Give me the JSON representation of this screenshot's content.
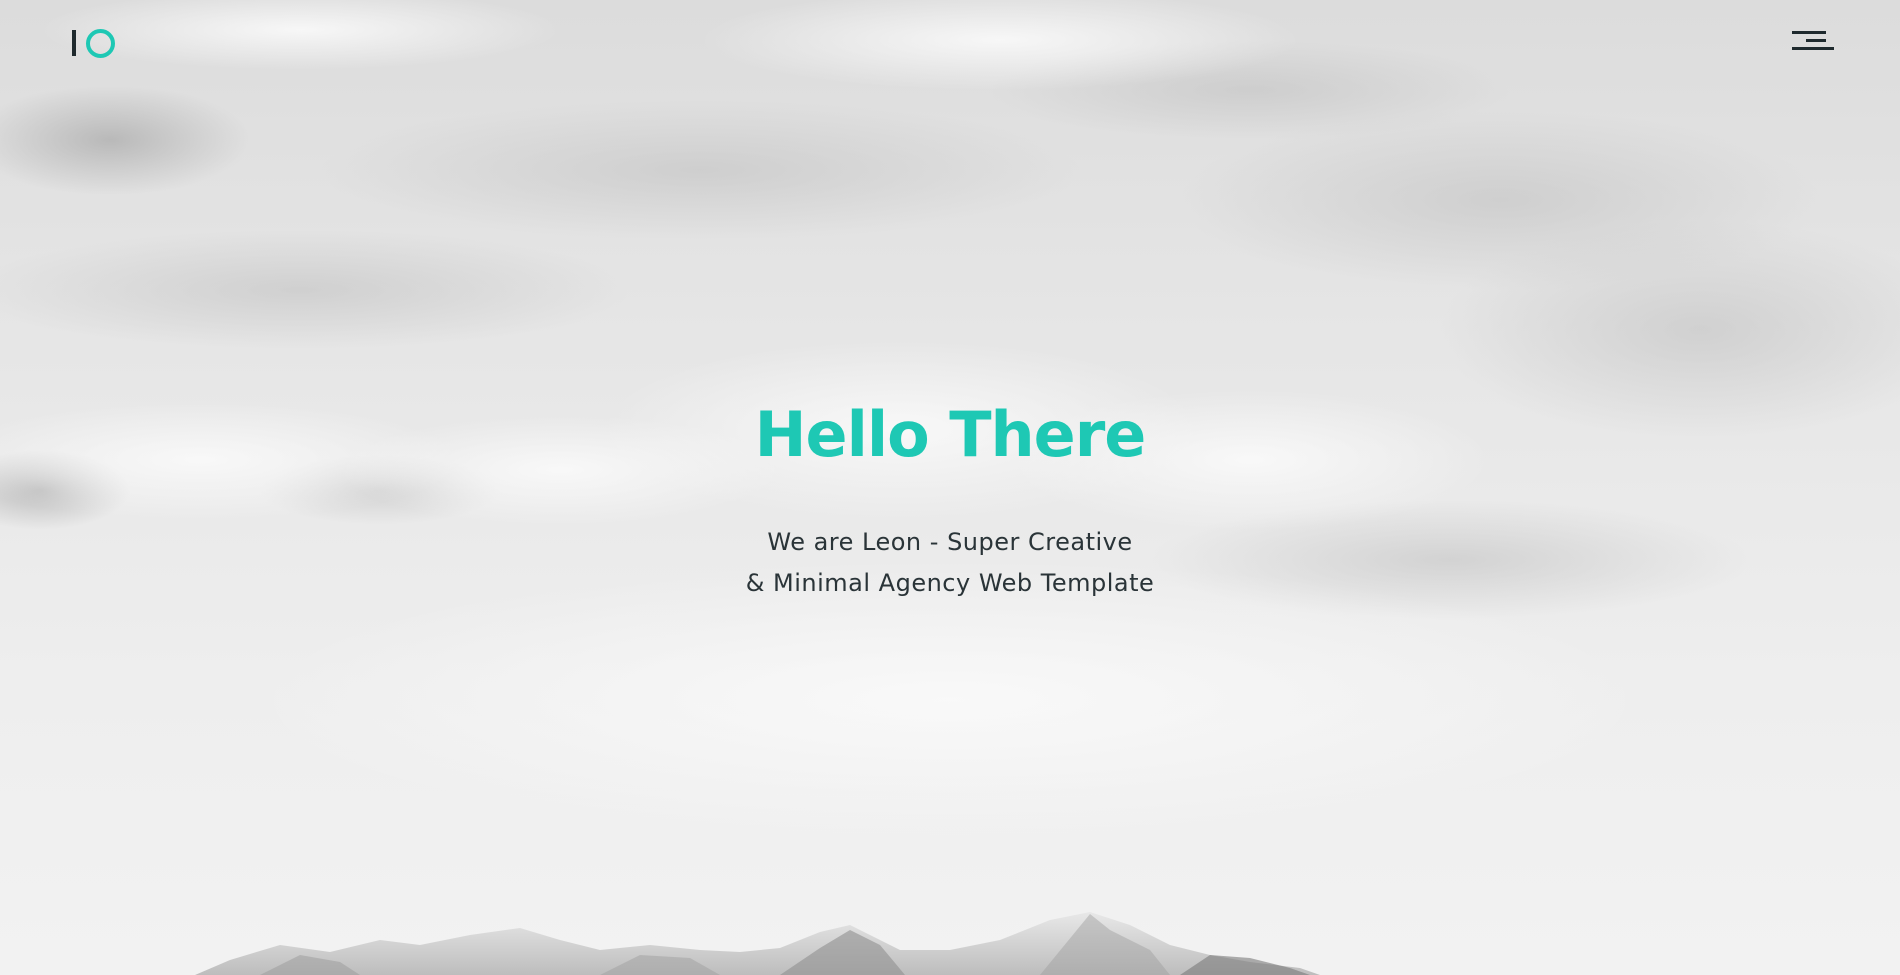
{
  "brand": {
    "logo_icon": "io-logo-icon",
    "accent_color": "#1ec8b4",
    "dark_color": "#1f2a2e"
  },
  "nav": {
    "menu_icon": "hamburger-menu-icon"
  },
  "hero": {
    "title": "Hello There",
    "subtitle_line1": "We are Leon - Super Creative",
    "subtitle_line2": "& Minimal Agency Web Template",
    "background": "grayscale-clouds-mountains-image"
  }
}
